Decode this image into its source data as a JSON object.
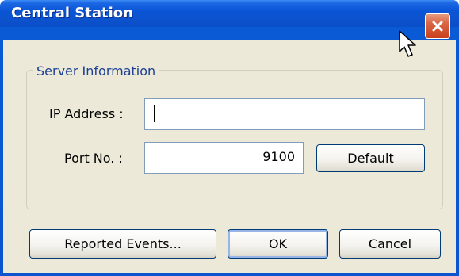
{
  "window": {
    "title": "Central Station"
  },
  "server_info": {
    "group_label": "Server Information",
    "ip_label": "IP Address :",
    "ip_value": "",
    "port_label": "Port No. :",
    "port_value": "9100",
    "default_label": "Default"
  },
  "buttons": {
    "reported_events": "Reported Events...",
    "ok": "OK",
    "cancel": "Cancel"
  },
  "icons": {
    "close": "close-icon",
    "cursor": "mouse-cursor-icon"
  },
  "colors": {
    "titlebar": "#0a55d6",
    "dialog_bg": "#ece9d8",
    "close_button": "#d86442",
    "group_label": "#1c3f94"
  }
}
